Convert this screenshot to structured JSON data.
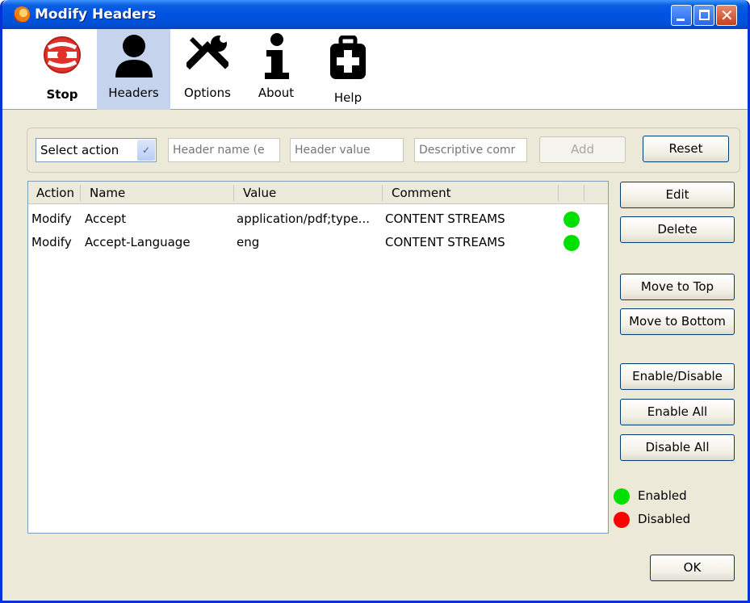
{
  "window": {
    "title": "Modify Headers"
  },
  "colors": {
    "enabled": "#00e000",
    "disabled": "#ff0000",
    "stop_icon": "#e0322b",
    "selected_tab_bg": "#c6d3ec"
  },
  "toolbar": {
    "items": [
      {
        "label": "Stop",
        "icon": "stop-icon"
      },
      {
        "label": "Headers",
        "icon": "person-icon"
      },
      {
        "label": "Options",
        "icon": "tools-icon"
      },
      {
        "label": "About",
        "icon": "info-icon"
      },
      {
        "label": "Help",
        "icon": "first-aid-icon"
      }
    ],
    "selected": "Headers"
  },
  "form": {
    "action_select_value": "Select action",
    "header_name_placeholder": "Header name (e",
    "header_value_placeholder": "Header value",
    "comment_placeholder": "Descriptive comr",
    "add_label": "Add",
    "reset_label": "Reset"
  },
  "table": {
    "columns": [
      "Action",
      "Name",
      "Value",
      "Comment"
    ],
    "rows": [
      {
        "action": "Modify",
        "name": "Accept",
        "value": "application/pdf;type...",
        "comment": "CONTENT STREAMS",
        "status": "enabled"
      },
      {
        "action": "Modify",
        "name": "Accept-Language",
        "value": "eng",
        "comment": "CONTENT STREAMS",
        "status": "enabled"
      }
    ]
  },
  "side_buttons": {
    "edit": "Edit",
    "delete": "Delete",
    "move_top": "Move to Top",
    "move_bottom": "Move to Bottom",
    "enable_disable": "Enable/Disable",
    "enable_all": "Enable All",
    "disable_all": "Disable All"
  },
  "legend": {
    "enabled": "Enabled",
    "disabled": "Disabled"
  },
  "footer": {
    "ok_label": "OK"
  }
}
